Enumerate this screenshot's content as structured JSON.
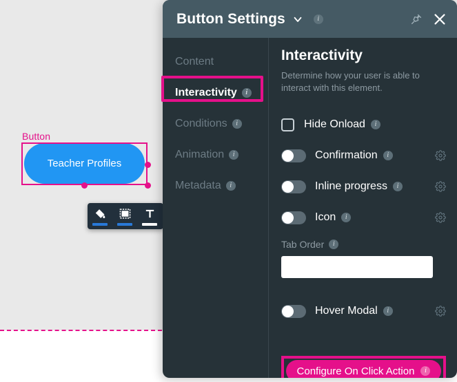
{
  "canvas": {
    "widget_label": "Button",
    "button_text": "Teacher Profiles",
    "button_color": "#2196f3",
    "selection_color": "#e5108a",
    "guide_color": "#e5108a",
    "toolbar": {
      "items": [
        {
          "icon": "paint-bucket-icon",
          "underline_color": "#2979d8"
        },
        {
          "icon": "border-box-icon",
          "underline_color": "#2979d8"
        },
        {
          "icon": "text-format-icon",
          "underline_color": "#ffffff"
        }
      ]
    }
  },
  "panel": {
    "header": {
      "title": "Button Settings",
      "chevron": "chevron-down-icon",
      "info": "i",
      "pin": "pin-icon",
      "close": "close-icon"
    },
    "sidebar": {
      "items": [
        {
          "label": "Content",
          "info": "",
          "active": false
        },
        {
          "label": "Interactivity",
          "info": "i",
          "active": true
        },
        {
          "label": "Conditions",
          "info": "i",
          "active": false
        },
        {
          "label": "Animation",
          "info": "i",
          "active": false
        },
        {
          "label": "Metadata",
          "info": "i",
          "active": false
        }
      ]
    },
    "content": {
      "title": "Interactivity",
      "description": "Determine how your user is able to interact with this element.",
      "hide_onload": {
        "label": "Hide Onload",
        "info": "i",
        "checked": false
      },
      "toggles": [
        {
          "label": "Confirmation",
          "info": "i",
          "on": false,
          "gear": "gear-icon"
        },
        {
          "label": "Inline progress",
          "info": "i",
          "on": false,
          "gear": "gear-icon"
        },
        {
          "label": "Icon",
          "info": "i",
          "on": false,
          "gear": "gear-icon"
        }
      ],
      "tab_order": {
        "label": "Tab Order",
        "info": "i",
        "value": "",
        "placeholder": ""
      },
      "hover_modal": {
        "label": "Hover Modal",
        "info": "i",
        "on": false,
        "gear": "gear-icon"
      },
      "configure_button": {
        "label": "Configure On Click Action",
        "info": "i",
        "color": "#e5108a"
      }
    }
  },
  "highlight_color": "#e5108a"
}
